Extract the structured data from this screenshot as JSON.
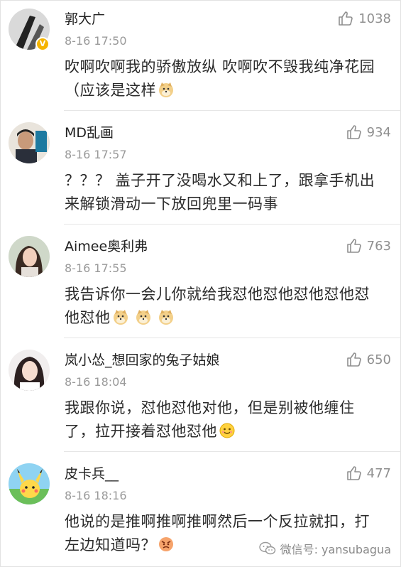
{
  "comments": [
    {
      "username": "郭大广",
      "time": "8-16 17:50",
      "likes": "1038",
      "text": "吹啊吹啊我的骄傲放纵 吹啊吹不毁我纯净花园（应该是这样",
      "emoji": [
        "doge-icon"
      ],
      "verified_badge": "V"
    },
    {
      "username": "MD乱画",
      "time": "8-16 17:57",
      "likes": "934",
      "text": "？？？ 盖子开了没喝水又和上了，跟拿手机出来解锁滑动一下放回兜里一码事",
      "emoji": []
    },
    {
      "username": "Aimee奥利弗",
      "time": "8-16 17:55",
      "likes": "763",
      "text": "我告诉你一会儿你就给我怼他怼他怼他怼他怼他怼他",
      "emoji": [
        "doge-icon",
        "doge-icon",
        "doge-icon"
      ]
    },
    {
      "username": "岚小怂_想回家的兔子姑娘",
      "time": "8-16 18:04",
      "likes": "650",
      "text": "我跟你说，怼他怼他对他，但是别被他缠住了，拉开接着怼他怼他",
      "emoji": [
        "smile-icon"
      ]
    },
    {
      "username": "皮卡兵__",
      "time": "8-16 18:16",
      "likes": "477",
      "text": "他说的是推啊推啊推啊然后一个反拉就扣，打左边知道吗？",
      "emoji": [
        "angry-icon"
      ]
    }
  ],
  "watermark": {
    "label": "微信号: yansubagua"
  },
  "colors": {
    "text": "#2b2b2b",
    "meta": "#9a9a9a",
    "divider": "#e6e6e6",
    "badge": "#f5b400"
  }
}
